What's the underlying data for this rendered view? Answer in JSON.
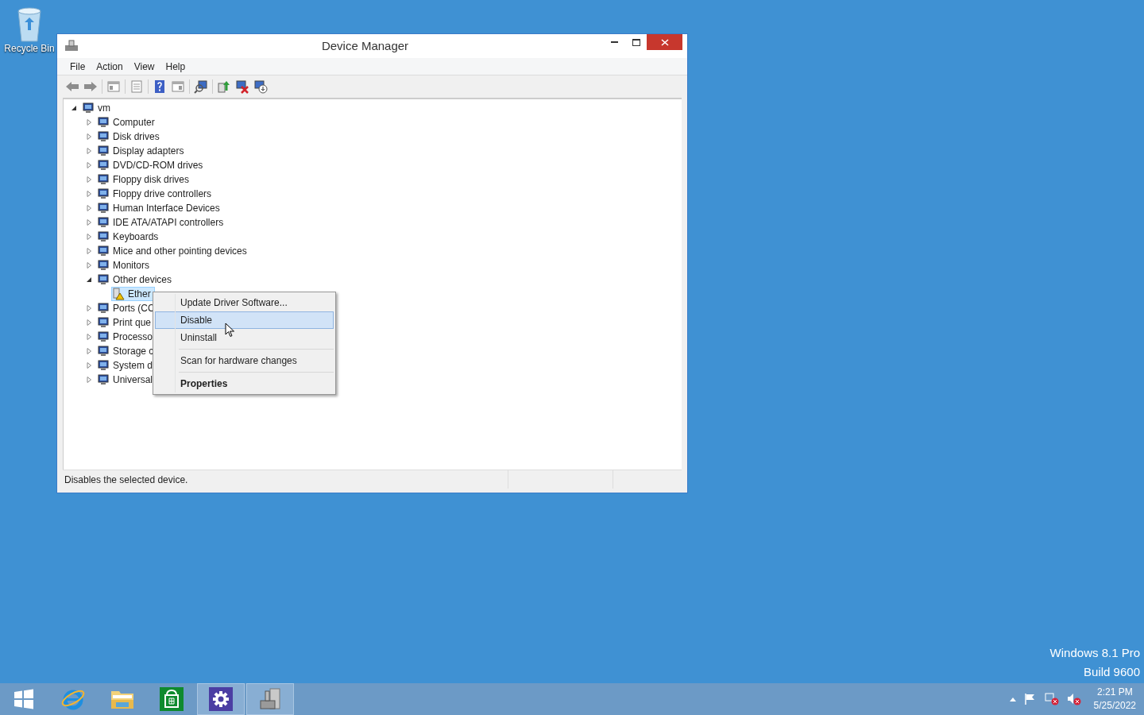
{
  "desktop": {
    "icons": [
      {
        "label": "Recycle Bin"
      }
    ],
    "watermark": [
      "Windows 8.1 Pro",
      "Build 9600"
    ]
  },
  "window": {
    "title": "Device Manager",
    "menu": [
      "File",
      "Action",
      "View",
      "Help"
    ],
    "tree": {
      "label": "vm",
      "expanded": true,
      "children": [
        {
          "label": "Computer",
          "expanded": false
        },
        {
          "label": "Disk drives",
          "expanded": false
        },
        {
          "label": "Display adapters",
          "expanded": false
        },
        {
          "label": "DVD/CD-ROM drives",
          "expanded": false
        },
        {
          "label": "Floppy disk drives",
          "expanded": false
        },
        {
          "label": "Floppy drive controllers",
          "expanded": false
        },
        {
          "label": "Human Interface Devices",
          "expanded": false
        },
        {
          "label": "IDE ATA/ATAPI controllers",
          "expanded": false
        },
        {
          "label": "Keyboards",
          "expanded": false
        },
        {
          "label": "Mice and other pointing devices",
          "expanded": false
        },
        {
          "label": "Monitors",
          "expanded": false
        },
        {
          "label": "Other devices",
          "expanded": true,
          "children": [
            {
              "label": "Ether",
              "selected": true
            }
          ]
        },
        {
          "label": "Ports (CC",
          "expanded": false
        },
        {
          "label": "Print que",
          "expanded": false
        },
        {
          "label": "Processo",
          "expanded": false
        },
        {
          "label": "Storage c",
          "expanded": false
        },
        {
          "label": "System d",
          "expanded": false
        },
        {
          "label": "Universal",
          "expanded": false
        }
      ]
    },
    "context_menu": [
      {
        "items": [
          {
            "label": "Update Driver Software...",
            "selected": false,
            "default": false
          },
          {
            "label": "Disable",
            "selected": true,
            "default": false
          },
          {
            "label": "Uninstall",
            "selected": false,
            "default": false
          }
        ]
      },
      {
        "items": [
          {
            "label": "Scan for hardware changes",
            "selected": false,
            "default": false
          }
        ]
      },
      {
        "items": [
          {
            "label": "Properties",
            "selected": false,
            "default": true
          }
        ]
      }
    ],
    "status_bar": "Disables the selected device."
  },
  "taskbar": {
    "apps": [
      {
        "kind": "start",
        "running": false
      },
      {
        "kind": "browser",
        "running": false
      },
      {
        "kind": "explorer",
        "running": false
      },
      {
        "kind": "store",
        "running": false
      },
      {
        "kind": "settings",
        "running": true
      },
      {
        "kind": "device-manager",
        "running": true
      }
    ],
    "time": "2:21 PM",
    "date": "5/25/2022"
  }
}
